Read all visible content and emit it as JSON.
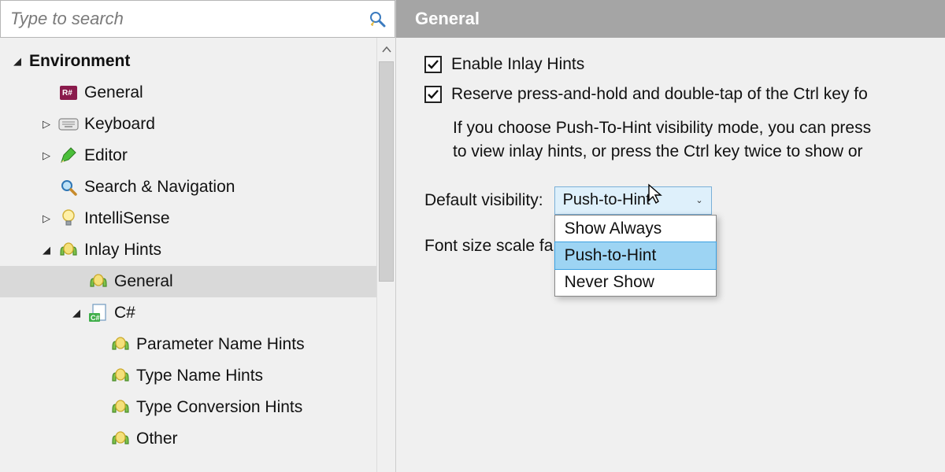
{
  "search": {
    "placeholder": "Type to search"
  },
  "tree": {
    "environment": "Environment",
    "general": "General",
    "keyboard": "Keyboard",
    "editor": "Editor",
    "search_nav": "Search & Navigation",
    "intellisense": "IntelliSense",
    "inlay_hints": "Inlay Hints",
    "inlay_general": "General",
    "csharp": "C#",
    "param_hints": "Parameter Name Hints",
    "type_name_hints": "Type Name Hints",
    "type_conv_hints": "Type Conversion Hints",
    "other": "Other"
  },
  "panel": {
    "header": "General",
    "chk_enable": "Enable Inlay Hints",
    "chk_reserve": "Reserve press-and-hold and double-tap of the Ctrl key fo",
    "help_line1": "If you choose Push-To-Hint visibility mode, you can press",
    "help_line2": "to view inlay hints, or press the Ctrl key twice to show or ",
    "visibility_label": "Default visibility:",
    "visibility_value": "Push-to-Hint",
    "visibility_options": [
      "Show Always",
      "Push-to-Hint",
      "Never Show"
    ],
    "font_scale_label": "Font size scale fa"
  }
}
